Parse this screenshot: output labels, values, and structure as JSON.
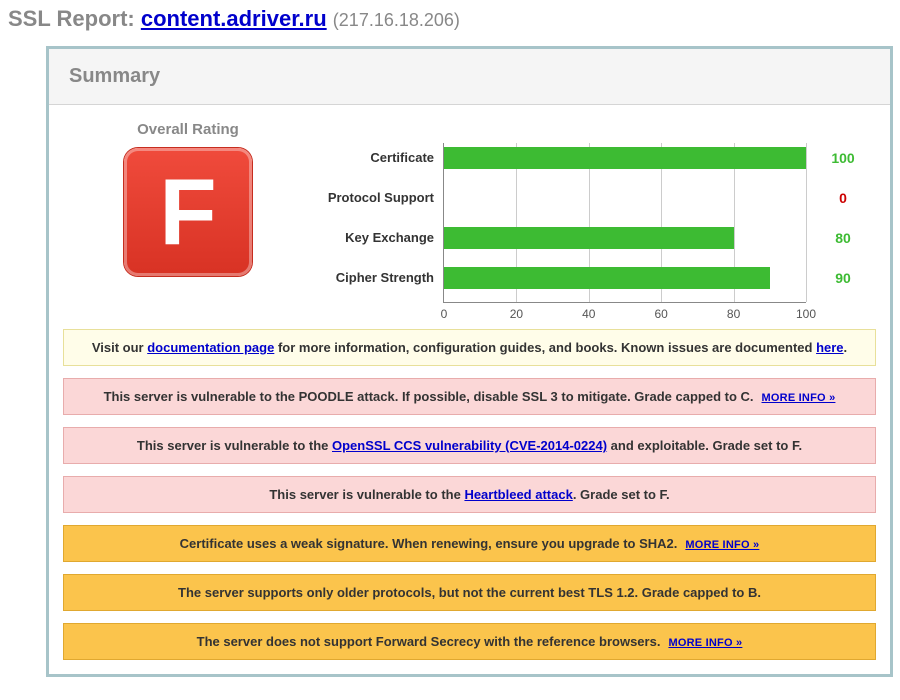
{
  "header": {
    "prefix": "SSL Report: ",
    "domain": "content.adriver.ru",
    "ip": "(217.16.18.206)"
  },
  "summary_label": "Summary",
  "rating": {
    "label": "Overall Rating",
    "grade": "F"
  },
  "chart_data": {
    "type": "bar",
    "xlim": [
      0,
      100
    ],
    "ticks": [
      0,
      20,
      40,
      60,
      80,
      100
    ],
    "categories": [
      "Certificate",
      "Protocol Support",
      "Key Exchange",
      "Cipher Strength"
    ],
    "values": [
      100,
      0,
      80,
      90
    ],
    "colors": {
      "bar": "#3dbb33",
      "value_good": "#3dbb33",
      "value_bad": "#cc0000"
    }
  },
  "notices": [
    {
      "style": "yellow",
      "parts": [
        {
          "t": "text",
          "v": "Visit our "
        },
        {
          "t": "link",
          "v": "documentation page"
        },
        {
          "t": "text",
          "v": " for more information, configuration guides, and books. Known issues are documented "
        },
        {
          "t": "link",
          "v": "here"
        },
        {
          "t": "text",
          "v": "."
        }
      ]
    },
    {
      "style": "pink",
      "parts": [
        {
          "t": "text",
          "v": "This server is vulnerable to the POODLE attack. If possible, disable SSL 3 to mitigate. Grade capped to C."
        },
        {
          "t": "moreinfo",
          "v": "MORE INFO »"
        }
      ]
    },
    {
      "style": "pink",
      "parts": [
        {
          "t": "text",
          "v": "This server is vulnerable to the "
        },
        {
          "t": "link",
          "v": "OpenSSL CCS vulnerability (CVE-2014-0224)"
        },
        {
          "t": "text",
          "v": " and exploitable. Grade set to F."
        }
      ]
    },
    {
      "style": "pink",
      "parts": [
        {
          "t": "text",
          "v": "This server is vulnerable to the "
        },
        {
          "t": "link",
          "v": "Heartbleed attack"
        },
        {
          "t": "text",
          "v": ". Grade set to F."
        }
      ]
    },
    {
      "style": "orange",
      "parts": [
        {
          "t": "text",
          "v": "Certificate uses a weak signature. When renewing, ensure you upgrade to SHA2."
        },
        {
          "t": "moreinfo",
          "v": "MORE INFO »"
        }
      ]
    },
    {
      "style": "orange",
      "parts": [
        {
          "t": "text",
          "v": "The server supports only older protocols, but not the current best TLS 1.2. Grade capped to B."
        }
      ]
    },
    {
      "style": "orange",
      "parts": [
        {
          "t": "text",
          "v": "The server does not support Forward Secrecy with the reference browsers."
        },
        {
          "t": "moreinfo",
          "v": "MORE INFO »"
        }
      ]
    }
  ]
}
